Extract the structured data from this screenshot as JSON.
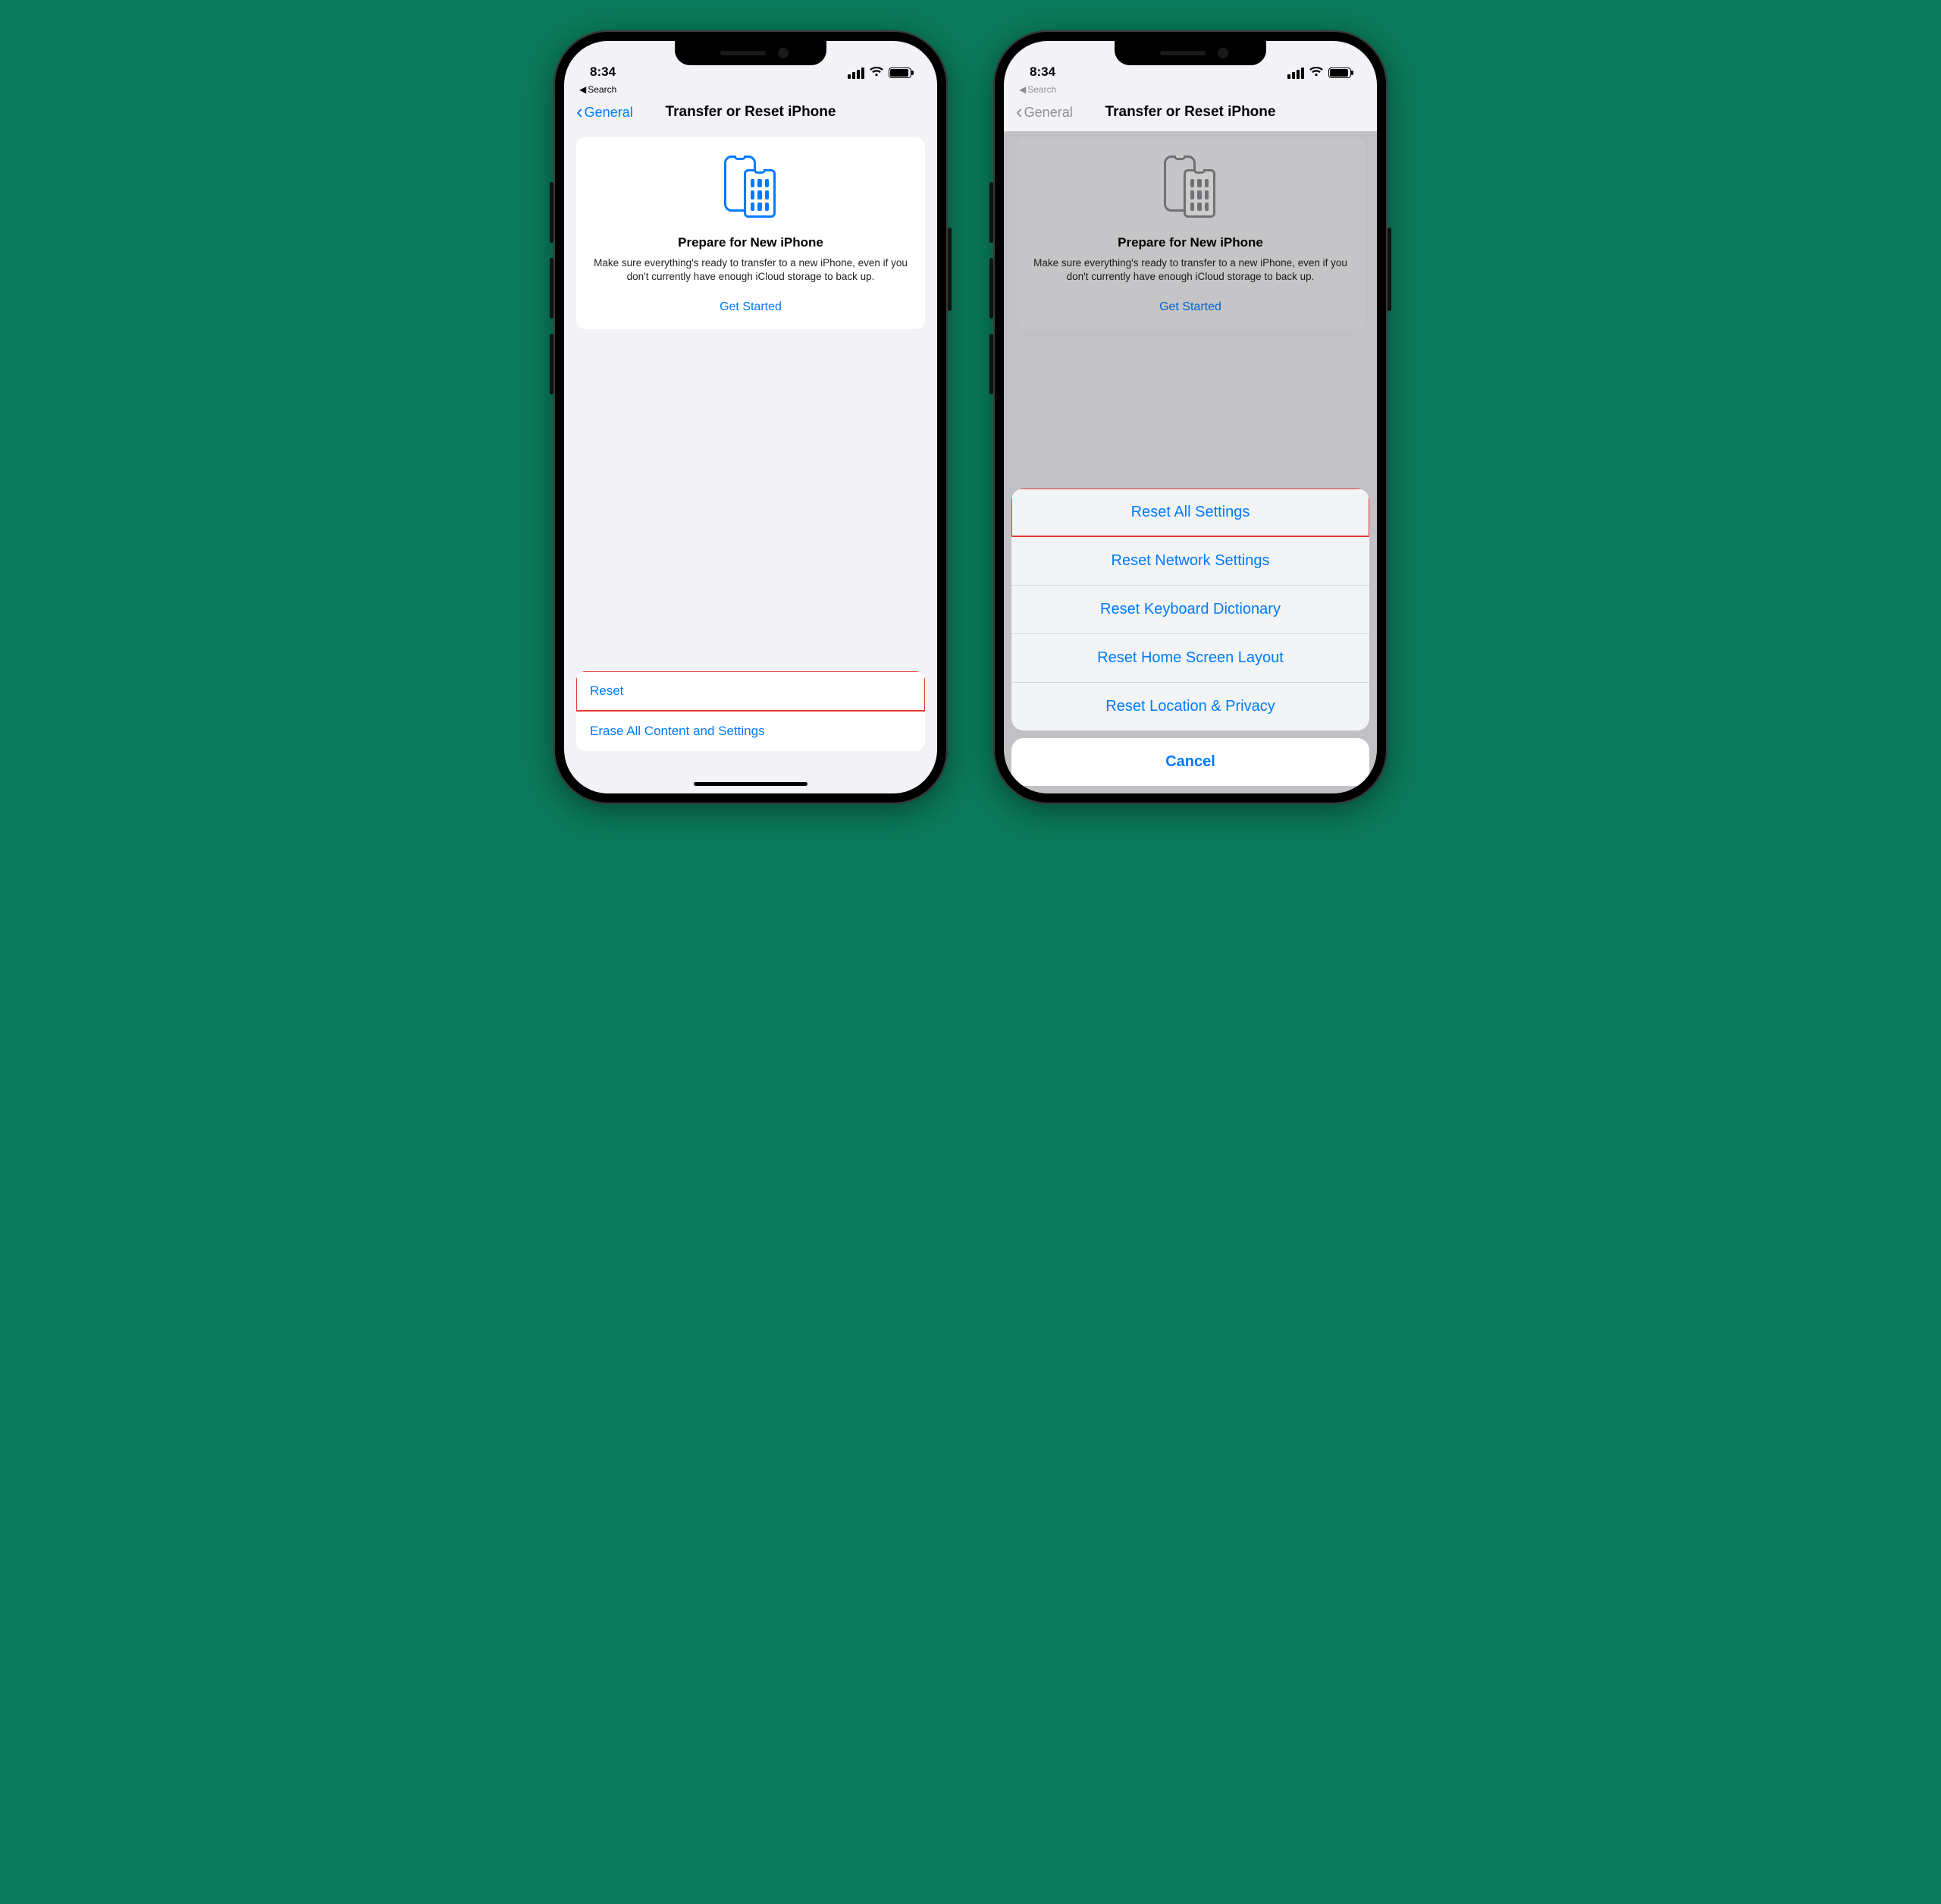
{
  "status": {
    "time": "8:34"
  },
  "breadcrumb": {
    "label": "Search"
  },
  "nav": {
    "back": "General",
    "title": "Transfer or Reset iPhone"
  },
  "prepare": {
    "heading": "Prepare for New iPhone",
    "body": "Make sure everything's ready to transfer to a new iPhone, even if you don't currently have enough iCloud storage to back up.",
    "cta": "Get Started"
  },
  "bottom": {
    "reset": "Reset",
    "erase": "Erase All Content and Settings"
  },
  "sheet": {
    "items": [
      "Reset All Settings",
      "Reset Network Settings",
      "Reset Keyboard Dictionary",
      "Reset Home Screen Layout",
      "Reset Location & Privacy"
    ],
    "cancel": "Cancel"
  },
  "annotation": {
    "highlight_color": "#e43c2e"
  }
}
